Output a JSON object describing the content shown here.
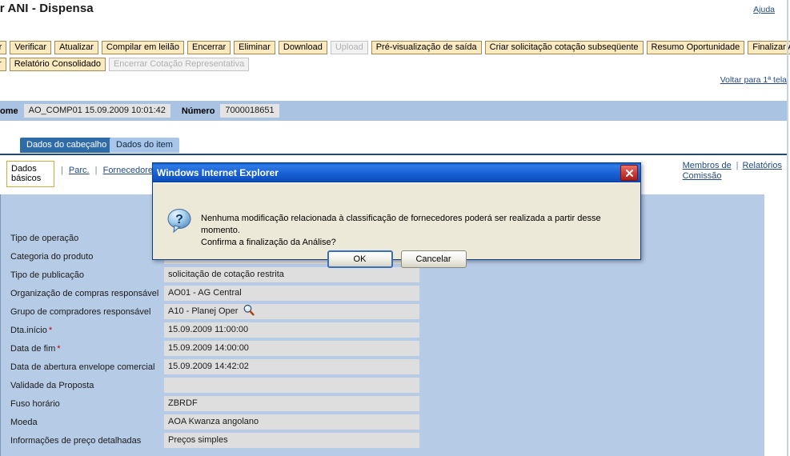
{
  "page": {
    "title": "ibir ANI - Dispensa",
    "help_label": "Ajuda",
    "back_label": "Voltar para 1ª tela"
  },
  "toolbar": {
    "row1": [
      {
        "label": "piar",
        "disabled": false
      },
      {
        "label": "Verificar",
        "disabled": false
      },
      {
        "label": "Atualizar",
        "disabled": false
      },
      {
        "label": "Compilar em leilão",
        "disabled": false
      },
      {
        "label": "Encerrar",
        "disabled": false
      },
      {
        "label": "Eliminar",
        "disabled": false
      },
      {
        "label": "Download",
        "disabled": false
      },
      {
        "label": "Upload",
        "disabled": true
      },
      {
        "label": "Pré-visualização de saída",
        "disabled": false
      },
      {
        "label": "Criar solicitação cotação subseqüente",
        "disabled": false
      },
      {
        "label": "Resumo Oportunidade",
        "disabled": false
      },
      {
        "label": "Finalizar Análise",
        "disabled": false
      }
    ],
    "row2": [
      {
        "label": "lvar",
        "disabled": false
      },
      {
        "label": "Relatório Consolidado",
        "disabled": false
      },
      {
        "label": "Encerrar Cotação Representativa",
        "disabled": true
      }
    ]
  },
  "idband": {
    "name_label": "ome",
    "name_value": "AO_COMP01 15.09.2009 10:01:42",
    "number_label": "Número",
    "number_value": "7000018651"
  },
  "tabs": [
    {
      "label": "Dados do cabeçalho",
      "active": true
    },
    {
      "label": "Dados do item",
      "active": false
    }
  ],
  "subnav": {
    "current_tab": "Dados básicos",
    "links": [
      "Parc.",
      "Fornecedores/C"
    ],
    "right_links": [
      "Membros de Comissão",
      "Relatórios"
    ],
    "right_link_1_line1": "Membros de",
    "right_link_1_line2": "Comissão",
    "right_link_2": "Relatórios"
  },
  "form": {
    "rows": [
      {
        "label": "Tipo de operação",
        "required": false,
        "value": "",
        "icon": ""
      },
      {
        "label": "Categoria do produto",
        "required": false,
        "value": "",
        "icon": ""
      },
      {
        "label": "Tipo de publicação",
        "required": false,
        "value": "solicitação de cotação restrita",
        "icon": ""
      },
      {
        "label": "Organização de compras responsável",
        "required": false,
        "value": "AO01 - AG Central",
        "icon": ""
      },
      {
        "label": "Grupo de compradores responsável",
        "required": false,
        "value": "A10 - Planej Oper",
        "icon": "magnifier-icon"
      },
      {
        "label": "Dta.início",
        "required": true,
        "value": "15.09.2009   11:00:00",
        "icon": ""
      },
      {
        "label": "Data de fim",
        "required": true,
        "value": "15.09.2009   14:00:00",
        "icon": ""
      },
      {
        "label": "Data de abertura envelope comercial",
        "required": false,
        "value": "15.09.2009   14:42:02",
        "icon": ""
      },
      {
        "label": "Validade da Proposta",
        "required": false,
        "value": "",
        "icon": ""
      },
      {
        "label": "Fuso horário",
        "required": false,
        "value": "ZBRDF",
        "icon": ""
      },
      {
        "label": "Moeda",
        "required": false,
        "value": "AOA Kwanza angolano",
        "icon": ""
      },
      {
        "label": "Informações de preço detalhadas",
        "required": false,
        "value": "Preços simples",
        "icon": ""
      }
    ]
  },
  "dialog": {
    "title": "Windows Internet Explorer",
    "message_line1": "Nenhuma modificação relacionada à classificação de fornecedores poderá ser realizada a partir desse momento.",
    "message_line2": "Confirma a finalização da Análise?",
    "ok_label": "OK",
    "cancel_label": "Cancelar",
    "icon": "question-bubble-icon",
    "close_icon": "close-icon"
  },
  "colors": {
    "button_face": "#fbe9bf",
    "button_border": "#a08a55",
    "band": "#abc3e3",
    "panel": "#b6cbe6",
    "active_tab": "#2f6ba6",
    "link": "#234a86",
    "required": "#cc0000",
    "dialog_title": "#1963d6"
  }
}
